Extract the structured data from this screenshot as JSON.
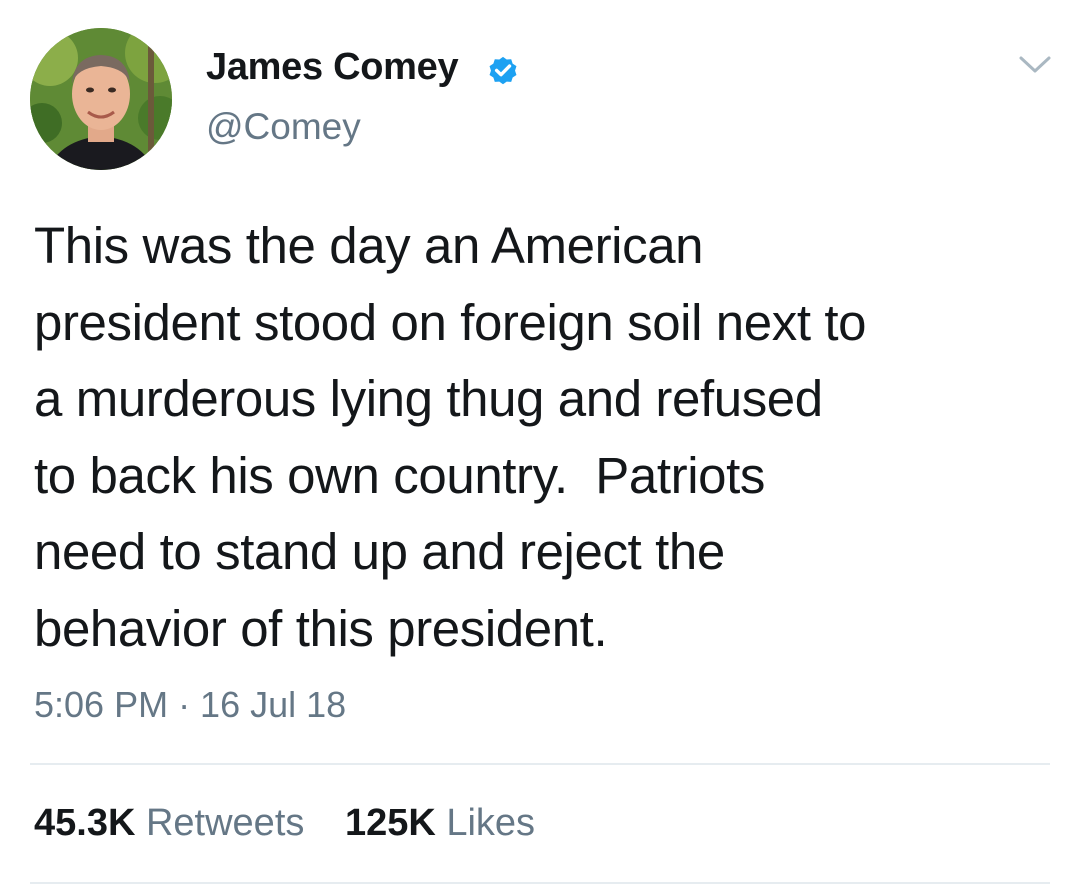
{
  "author": {
    "display_name": "James Comey",
    "handle": "@Comey",
    "verified": true
  },
  "tweet": {
    "text_lines": [
      "This was the day an American",
      "president stood on foreign soil next to",
      "a murderous lying thug and refused",
      "to back his own country.  Patriots",
      "need to stand up and reject the",
      "behavior of this president."
    ],
    "timestamp": "5:06 PM · 16 Jul 18"
  },
  "stats": {
    "retweets_count": "45.3K",
    "retweets_label": "Retweets",
    "likes_count": "125K",
    "likes_label": "Likes"
  },
  "colors": {
    "text": "#14171a",
    "secondary": "#657786",
    "verified_blue": "#1da1f2",
    "divider": "#e6ecf0"
  },
  "icons": {
    "verified": "verified-badge-icon",
    "caret": "chevron-down-icon"
  }
}
